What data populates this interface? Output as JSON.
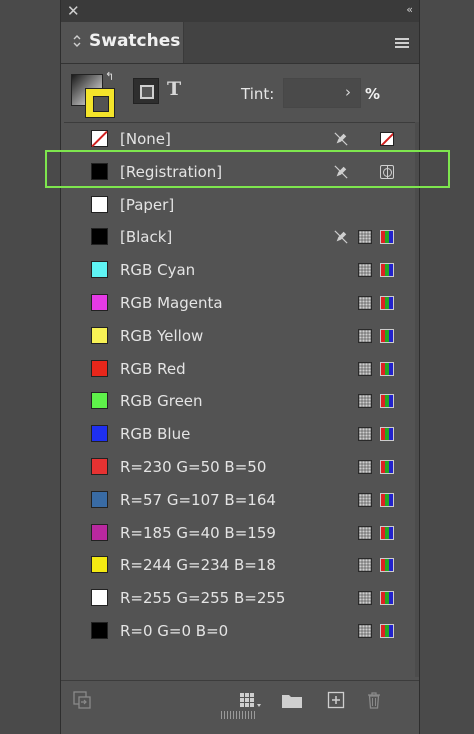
{
  "panel": {
    "tab_label": "Swatches",
    "tint_label": "Tint:",
    "tint_value": "",
    "tint_unit": "%",
    "text_toggle": "T"
  },
  "swatches": [
    {
      "name": "[None]",
      "color": "none",
      "locked": true,
      "mode": "none"
    },
    {
      "name": "[Registration]",
      "color": "#000000",
      "locked": true,
      "mode": "registration"
    },
    {
      "name": "[Paper]",
      "color": "#ffffff",
      "locked": false,
      "mode": ""
    },
    {
      "name": "[Black]",
      "color": "#000000",
      "locked": true,
      "mode": "process"
    },
    {
      "name": "RGB Cyan",
      "color": "#5ff5f5",
      "locked": false,
      "mode": "process"
    },
    {
      "name": "RGB Magenta",
      "color": "#e63ae6",
      "locked": false,
      "mode": "process"
    },
    {
      "name": "RGB Yellow",
      "color": "#f8f255",
      "locked": false,
      "mode": "process"
    },
    {
      "name": "RGB Red",
      "color": "#e8271b",
      "locked": false,
      "mode": "process"
    },
    {
      "name": "RGB Green",
      "color": "#5ef24a",
      "locked": false,
      "mode": "process"
    },
    {
      "name": "RGB Blue",
      "color": "#1e2ff0",
      "locked": false,
      "mode": "process"
    },
    {
      "name": "R=230 G=50 B=50",
      "color": "#e63232",
      "locked": false,
      "mode": "process"
    },
    {
      "name": "R=57 G=107 B=164",
      "color": "#396ba4",
      "locked": false,
      "mode": "process"
    },
    {
      "name": "R=185 G=40 B=159",
      "color": "#b9289f",
      "locked": false,
      "mode": "process"
    },
    {
      "name": "R=244 G=234 B=18",
      "color": "#f4ea12",
      "locked": false,
      "mode": "process"
    },
    {
      "name": "R=255 G=255 B=255",
      "color": "#ffffff",
      "locked": false,
      "mode": "process"
    },
    {
      "name": "R=0 G=0 B=0",
      "color": "#000000",
      "locked": false,
      "mode": "process"
    }
  ],
  "icons": {
    "close": "close-icon",
    "collapse": "collapse-icon",
    "menu": "panel-menu-icon",
    "lock": "pen-locked-icon",
    "grid_view": "swatch-views-icon",
    "folder": "new-color-group-icon",
    "add": "new-swatch-icon",
    "trash": "delete-swatch-icon",
    "place": "place-swatches-icon"
  }
}
